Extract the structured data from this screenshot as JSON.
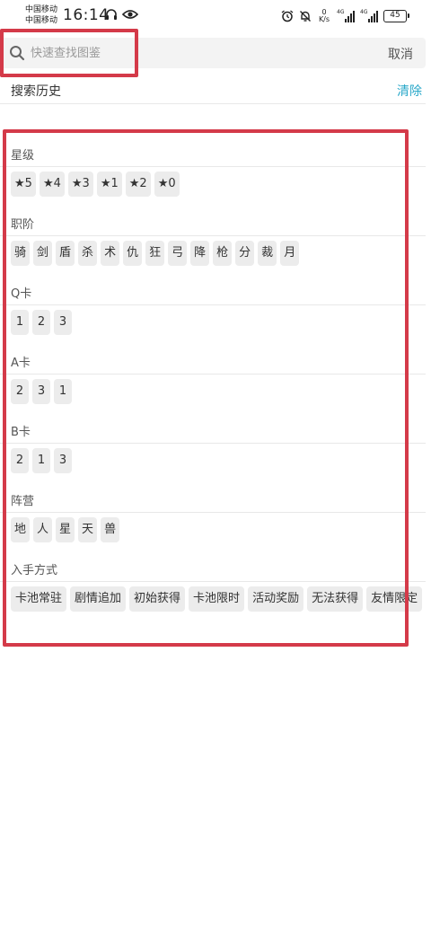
{
  "status_bar": {
    "carrier_1": "中国移动",
    "carrier_2": "中国移动",
    "time": "16:14",
    "net_speed_value": "0",
    "net_speed_unit": "K/s",
    "signal_1_label": "4G",
    "signal_2_label": "4G",
    "battery": "45"
  },
  "search": {
    "placeholder": "快速查找图鉴",
    "value": "",
    "cancel_label": "取消"
  },
  "history": {
    "title": "搜索历史",
    "clear_label": "清除"
  },
  "filters": [
    {
      "title": "星级",
      "options": [
        "★5",
        "★4",
        "★3",
        "★1",
        "★2",
        "★0"
      ]
    },
    {
      "title": "职阶",
      "options": [
        "骑",
        "剑",
        "盾",
        "杀",
        "术",
        "仇",
        "狂",
        "弓",
        "降",
        "枪",
        "分",
        "裁",
        "月"
      ]
    },
    {
      "title": "Q卡",
      "options": [
        "1",
        "2",
        "3"
      ]
    },
    {
      "title": "A卡",
      "options": [
        "2",
        "3",
        "1"
      ]
    },
    {
      "title": "B卡",
      "options": [
        "2",
        "1",
        "3"
      ]
    },
    {
      "title": "阵营",
      "options": [
        "地",
        "人",
        "星",
        "天",
        "兽"
      ]
    },
    {
      "title": "入手方式",
      "options": [
        "卡池常驻",
        "剧情追加",
        "初始获得",
        "卡池限时",
        "活动奖励",
        "无法获得",
        "友情限定"
      ]
    }
  ],
  "colors": {
    "accent": "#2aa8c9",
    "chip_bg": "#ececec",
    "annotation": "#d43a49"
  }
}
